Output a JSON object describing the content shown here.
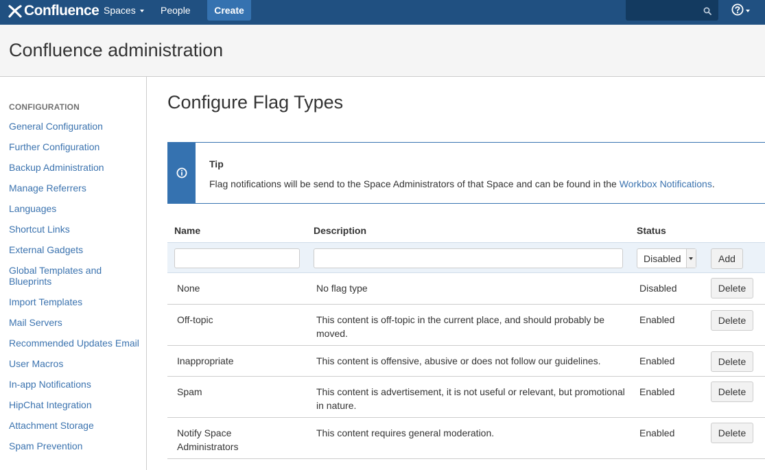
{
  "nav": {
    "logo_text": "Confluence",
    "spaces_label": "Spaces",
    "people_label": "People",
    "create_label": "Create",
    "search_placeholder": ""
  },
  "header": {
    "title": "Confluence administration"
  },
  "sidebar": {
    "heading": "CONFIGURATION",
    "items": [
      "General Configuration",
      "Further Configuration",
      "Backup Administration",
      "Manage Referrers",
      "Languages",
      "Shortcut Links",
      "External Gadgets",
      "Global Templates and Blueprints",
      "Import Templates",
      "Mail Servers",
      "Recommended Updates Email",
      "User Macros",
      "In-app Notifications",
      "HipChat Integration",
      "Attachment Storage",
      "Spam Prevention"
    ]
  },
  "main": {
    "title": "Configure Flag Types",
    "tip": {
      "title": "Tip",
      "body": "Flag notifications will be send to the Space Administrators of that Space and can be found in the ",
      "link": "Workbox Notifications",
      "suffix": "."
    },
    "table": {
      "headers": {
        "name": "Name",
        "description": "Description",
        "status": "Status"
      },
      "add_row": {
        "name_value": "",
        "description_value": "",
        "status_selected": "Disabled",
        "add_label": "Add"
      },
      "delete_label": "Delete",
      "rows": [
        {
          "name": "None",
          "description": "No flag type",
          "status": "Disabled"
        },
        {
          "name": "Off-topic",
          "description": "This content is off-topic in the current place, and should probably be moved.",
          "status": "Enabled"
        },
        {
          "name": "Inappropriate",
          "description": "This content is offensive, abusive or does not follow our guidelines.",
          "status": "Enabled"
        },
        {
          "name": "Spam",
          "description": "This content is advertisement, it is not useful or relevant, but promotional in nature.",
          "status": "Enabled"
        },
        {
          "name": "Notify Space Administrators",
          "description": "This content requires general moderation.",
          "status": "Enabled"
        }
      ]
    }
  },
  "colors": {
    "nav_bg": "#205081",
    "create_bg": "#3572b0",
    "link": "#3b73af",
    "tip_accent": "#3572b0"
  },
  "icons": {
    "logo": "confluence-x-icon",
    "search": "search-icon",
    "help": "help-icon",
    "tip": "info-icon"
  }
}
